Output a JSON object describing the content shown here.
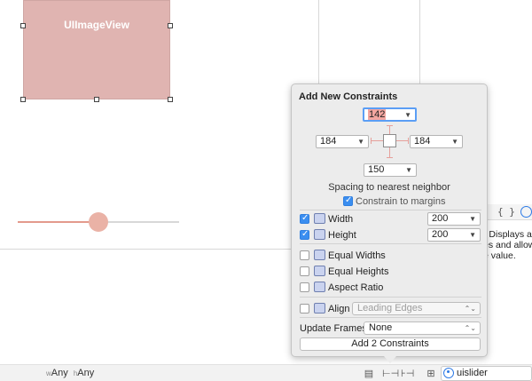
{
  "canvas": {
    "image_view_label": "UIImageView",
    "slider_value": 0.5
  },
  "size_class": {
    "w_prefix": "w",
    "w_value": "Any",
    "h_prefix": "h",
    "h_value": "Any"
  },
  "search": {
    "value": "uislider"
  },
  "inspector": {
    "braces": "{ }",
    "description": "- Displays a\nes and allow\ne value."
  },
  "popover": {
    "title": "Add New Constraints",
    "spacing": {
      "top": "142",
      "left": "184",
      "right": "184",
      "bottom": "150"
    },
    "spacing_caption": "Spacing to nearest neighbor",
    "constrain_to_margins": {
      "label": "Constrain to margins",
      "checked": true
    },
    "rows": [
      {
        "label": "Width",
        "checked": true,
        "value": "200"
      },
      {
        "label": "Height",
        "checked": true,
        "value": "200"
      },
      {
        "label": "Equal Widths",
        "checked": false
      },
      {
        "label": "Equal Heights",
        "checked": false
      },
      {
        "label": "Aspect Ratio",
        "checked": false
      }
    ],
    "align": {
      "label": "Align",
      "checked": false,
      "value": "Leading Edges"
    },
    "update_frames": {
      "label": "Update Frames",
      "value": "None"
    },
    "add_button": "Add 2 Constraints"
  },
  "colors": {
    "accent": "#3b8ef0",
    "image_view_fill": "#e0b4b1",
    "slider_min": "#e39a8c",
    "strut": "#e6a09b"
  }
}
